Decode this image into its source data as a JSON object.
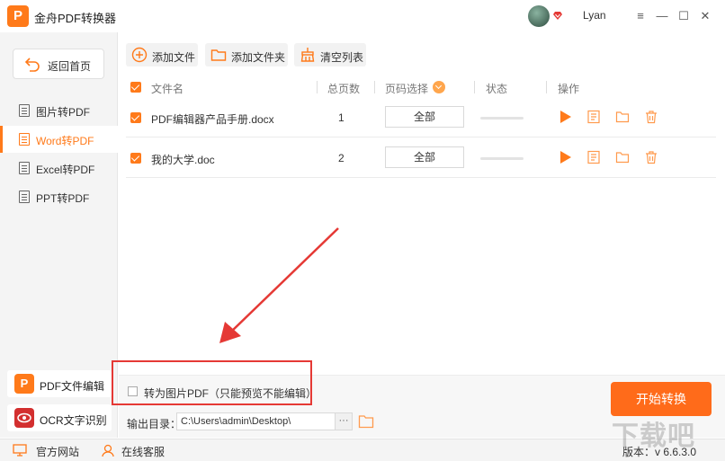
{
  "app": {
    "logo_letter": "P",
    "title": "金舟PDF转换器",
    "username": "Lyan",
    "window_controls": [
      "≡",
      "—",
      "☐",
      "✕"
    ]
  },
  "sidebar": {
    "back_label": "返回首页",
    "items": [
      {
        "label": "图片转PDF",
        "active": false
      },
      {
        "label": "Word转PDF",
        "active": true
      },
      {
        "label": "Excel转PDF",
        "active": false
      },
      {
        "label": "PPT转PDF",
        "active": false
      }
    ],
    "tools": [
      {
        "label": "PDF文件编辑",
        "icon": "P",
        "color": "#ff7a1a"
      },
      {
        "label": "OCR文字识别",
        "icon": "eye",
        "color": "#d32f2f"
      }
    ]
  },
  "toolbar": {
    "add_file": "添加文件",
    "add_folder": "添加文件夹",
    "clear_list": "清空列表"
  },
  "table": {
    "headers": {
      "name": "文件名",
      "pages": "总页数",
      "page_select": "页码选择",
      "status": "状态",
      "actions": "操作"
    },
    "rows": [
      {
        "name": "PDF编辑器产品手册.docx",
        "pages": "1",
        "page_select": "全部",
        "progress": 0
      },
      {
        "name": "我的大学.doc",
        "pages": "2",
        "page_select": "全部",
        "progress": 0
      }
    ]
  },
  "bottom": {
    "convert_to_image_label": "转为图片PDF（只能预览不能编辑）",
    "convert_to_image_checked": false,
    "output_label": "输出目录：",
    "output_path": "C:\\Users\\admin\\Desktop\\",
    "more_label": "···",
    "start_label": "开始转换"
  },
  "statusbar": {
    "website": "官方网站",
    "support": "在线客服",
    "version": "版本：v 6.6.3.0"
  },
  "watermark": "下载吧",
  "colors": {
    "accent": "#ff7a1a",
    "highlight_box": "#e53935"
  }
}
